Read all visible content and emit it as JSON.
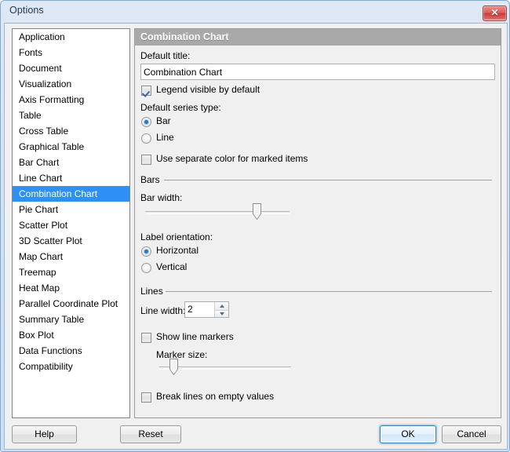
{
  "window": {
    "title": "Options",
    "close_icon": "close-icon",
    "close_glyph": "✕"
  },
  "sidebar": {
    "items": [
      {
        "label": "Application",
        "selected": false
      },
      {
        "label": "Fonts",
        "selected": false
      },
      {
        "label": "Document",
        "selected": false
      },
      {
        "label": "Visualization",
        "selected": false
      },
      {
        "label": "Axis Formatting",
        "selected": false
      },
      {
        "label": "Table",
        "selected": false
      },
      {
        "label": "Cross Table",
        "selected": false
      },
      {
        "label": "Graphical Table",
        "selected": false
      },
      {
        "label": "Bar Chart",
        "selected": false
      },
      {
        "label": "Line Chart",
        "selected": false
      },
      {
        "label": "Combination Chart",
        "selected": true
      },
      {
        "label": "Pie Chart",
        "selected": false
      },
      {
        "label": "Scatter Plot",
        "selected": false
      },
      {
        "label": "3D Scatter Plot",
        "selected": false
      },
      {
        "label": "Map Chart",
        "selected": false
      },
      {
        "label": "Treemap",
        "selected": false
      },
      {
        "label": "Heat Map",
        "selected": false
      },
      {
        "label": "Parallel Coordinate Plot",
        "selected": false
      },
      {
        "label": "Summary Table",
        "selected": false
      },
      {
        "label": "Box Plot",
        "selected": false
      },
      {
        "label": "Data Functions",
        "selected": false
      },
      {
        "label": "Compatibility",
        "selected": false
      }
    ],
    "selection_color": "#2e90f5"
  },
  "panel": {
    "header": "Combination Chart",
    "header_bg": "#a9a9a9",
    "default_title_label": "Default title:",
    "default_title_value": "Combination Chart",
    "default_title_placeholder": "",
    "legend_checkbox": {
      "label": "Legend visible by default",
      "checked": true
    },
    "series_type_label": "Default series type:",
    "series_type_options": [
      {
        "label": "Bar",
        "selected": true
      },
      {
        "label": "Line",
        "selected": false
      }
    ],
    "marked_items_checkbox": {
      "label": "Use separate color for marked items",
      "checked": false
    },
    "bars_group": {
      "title": "Bars",
      "bar_width_label": "Bar width:",
      "bar_width_percent": 79,
      "label_orientation_label": "Label orientation:",
      "label_orientation_options": [
        {
          "label": "Horizontal",
          "selected": true
        },
        {
          "label": "Vertical",
          "selected": false
        }
      ]
    },
    "lines_group": {
      "title": "Lines",
      "line_width_label": "Line width:",
      "line_width_value": "2",
      "show_markers_checkbox": {
        "label": "Show line markers",
        "checked": false
      },
      "marker_size_label": "Marker size:",
      "marker_size_percent": 8,
      "break_lines_checkbox": {
        "label": "Break lines on empty values",
        "checked": false
      }
    }
  },
  "footer": {
    "help": "Help",
    "reset": "Reset",
    "ok": "OK",
    "cancel": "Cancel"
  }
}
